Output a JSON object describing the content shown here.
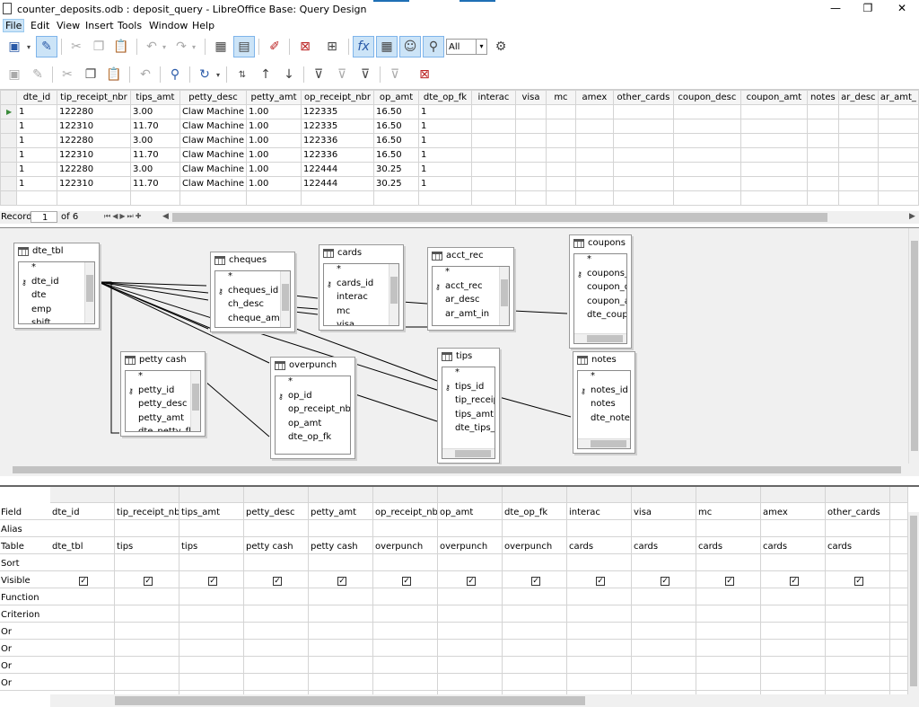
{
  "window": {
    "title": "counter_deposits.odb : deposit_query - LibreOffice Base: Query Design",
    "minimize": "—",
    "restore": "❐",
    "close": "✕"
  },
  "menu": [
    "File",
    "Edit",
    "View",
    "Insert",
    "Tools",
    "Window",
    "Help"
  ],
  "toolbar": {
    "limit_value": "All"
  },
  "results": {
    "columns": [
      "dte_id",
      "tip_receipt_nbr",
      "tips_amt",
      "petty_desc",
      "petty_amt",
      "op_receipt_nbr",
      "op_amt",
      "dte_op_fk",
      "interac",
      "visa",
      "mc",
      "amex",
      "other_cards",
      "coupon_desc",
      "coupon_amt",
      "notes",
      "ar_desc",
      "ar_amt_"
    ],
    "rows": [
      [
        "1",
        "122280",
        "3.00",
        "Claw Machine",
        "1.00",
        "122335",
        "16.50",
        "1",
        "",
        "",
        "",
        "",
        "",
        "",
        "",
        "",
        "",
        ""
      ],
      [
        "1",
        "122310",
        "11.70",
        "Claw Machine",
        "1.00",
        "122335",
        "16.50",
        "1",
        "",
        "",
        "",
        "",
        "",
        "",
        "",
        "",
        "",
        ""
      ],
      [
        "1",
        "122280",
        "3.00",
        "Claw Machine",
        "1.00",
        "122336",
        "16.50",
        "1",
        "",
        "",
        "",
        "",
        "",
        "",
        "",
        "",
        "",
        ""
      ],
      [
        "1",
        "122310",
        "11.70",
        "Claw Machine",
        "1.00",
        "122336",
        "16.50",
        "1",
        "",
        "",
        "",
        "",
        "",
        "",
        "",
        "",
        "",
        ""
      ],
      [
        "1",
        "122280",
        "3.00",
        "Claw Machine",
        "1.00",
        "122444",
        "30.25",
        "1",
        "",
        "",
        "",
        "",
        "",
        "",
        "",
        "",
        "",
        ""
      ],
      [
        "1",
        "122310",
        "11.70",
        "Claw Machine",
        "1.00",
        "122444",
        "30.25",
        "1",
        "",
        "",
        "",
        "",
        "",
        "",
        "",
        "",
        "",
        ""
      ]
    ],
    "record_label": "Record",
    "record_value": "1",
    "record_of": "of 6"
  },
  "tables": {
    "dte_tbl": {
      "name": "dte_tbl",
      "fields": [
        "*",
        "dte_id",
        "dte",
        "emp",
        "shift"
      ]
    },
    "cheques": {
      "name": "cheques",
      "fields": [
        "*",
        "cheques_id",
        "ch_desc",
        "cheque_amt"
      ]
    },
    "cards": {
      "name": "cards",
      "fields": [
        "*",
        "cards_id",
        "interac",
        "mc",
        "visa"
      ]
    },
    "acct_rec": {
      "name": "acct_rec",
      "fields": [
        "*",
        "acct_rec",
        "ar_desc",
        "ar_amt_in"
      ]
    },
    "coupons": {
      "name": "coupons",
      "fields": [
        "*",
        "coupons_id",
        "coupon_desc",
        "coupon_amt",
        "dte_coupon"
      ]
    },
    "petty_cash": {
      "name": "petty cash",
      "fields": [
        "*",
        "petty_id",
        "petty_desc",
        "petty_amt",
        "dte_petty_fk"
      ]
    },
    "overpunch": {
      "name": "overpunch",
      "fields": [
        "*",
        "op_id",
        "op_receipt_nbr",
        "op_amt",
        "dte_op_fk"
      ]
    },
    "tips": {
      "name": "tips",
      "fields": [
        "*",
        "tips_id",
        "tip_receipt_nbr",
        "tips_amt",
        "dte_tips_fk"
      ]
    },
    "notes": {
      "name": "notes",
      "fields": [
        "*",
        "notes_id",
        "notes",
        "dte_notes_fk"
      ]
    }
  },
  "criteria": {
    "row_labels": [
      "Field",
      "Alias",
      "Table",
      "Sort",
      "Visible",
      "Function",
      "Criterion",
      "Or",
      "Or",
      "Or",
      "Or"
    ],
    "columns": [
      {
        "field": "dte_id",
        "table": "dte_tbl",
        "visible": true
      },
      {
        "field": "tip_receipt_nbr",
        "table": "tips",
        "visible": true
      },
      {
        "field": "tips_amt",
        "table": "tips",
        "visible": true
      },
      {
        "field": "petty_desc",
        "table": "petty cash",
        "visible": true
      },
      {
        "field": "petty_amt",
        "table": "petty cash",
        "visible": true
      },
      {
        "field": "op_receipt_nbr",
        "table": "overpunch",
        "visible": true
      },
      {
        "field": "op_amt",
        "table": "overpunch",
        "visible": true
      },
      {
        "field": "dte_op_fk",
        "table": "overpunch",
        "visible": true
      },
      {
        "field": "interac",
        "table": "cards",
        "visible": true
      },
      {
        "field": "visa",
        "table": "cards",
        "visible": true
      },
      {
        "field": "mc",
        "table": "cards",
        "visible": true
      },
      {
        "field": "amex",
        "table": "cards",
        "visible": true
      },
      {
        "field": "other_cards",
        "table": "cards",
        "visible": true
      }
    ]
  }
}
